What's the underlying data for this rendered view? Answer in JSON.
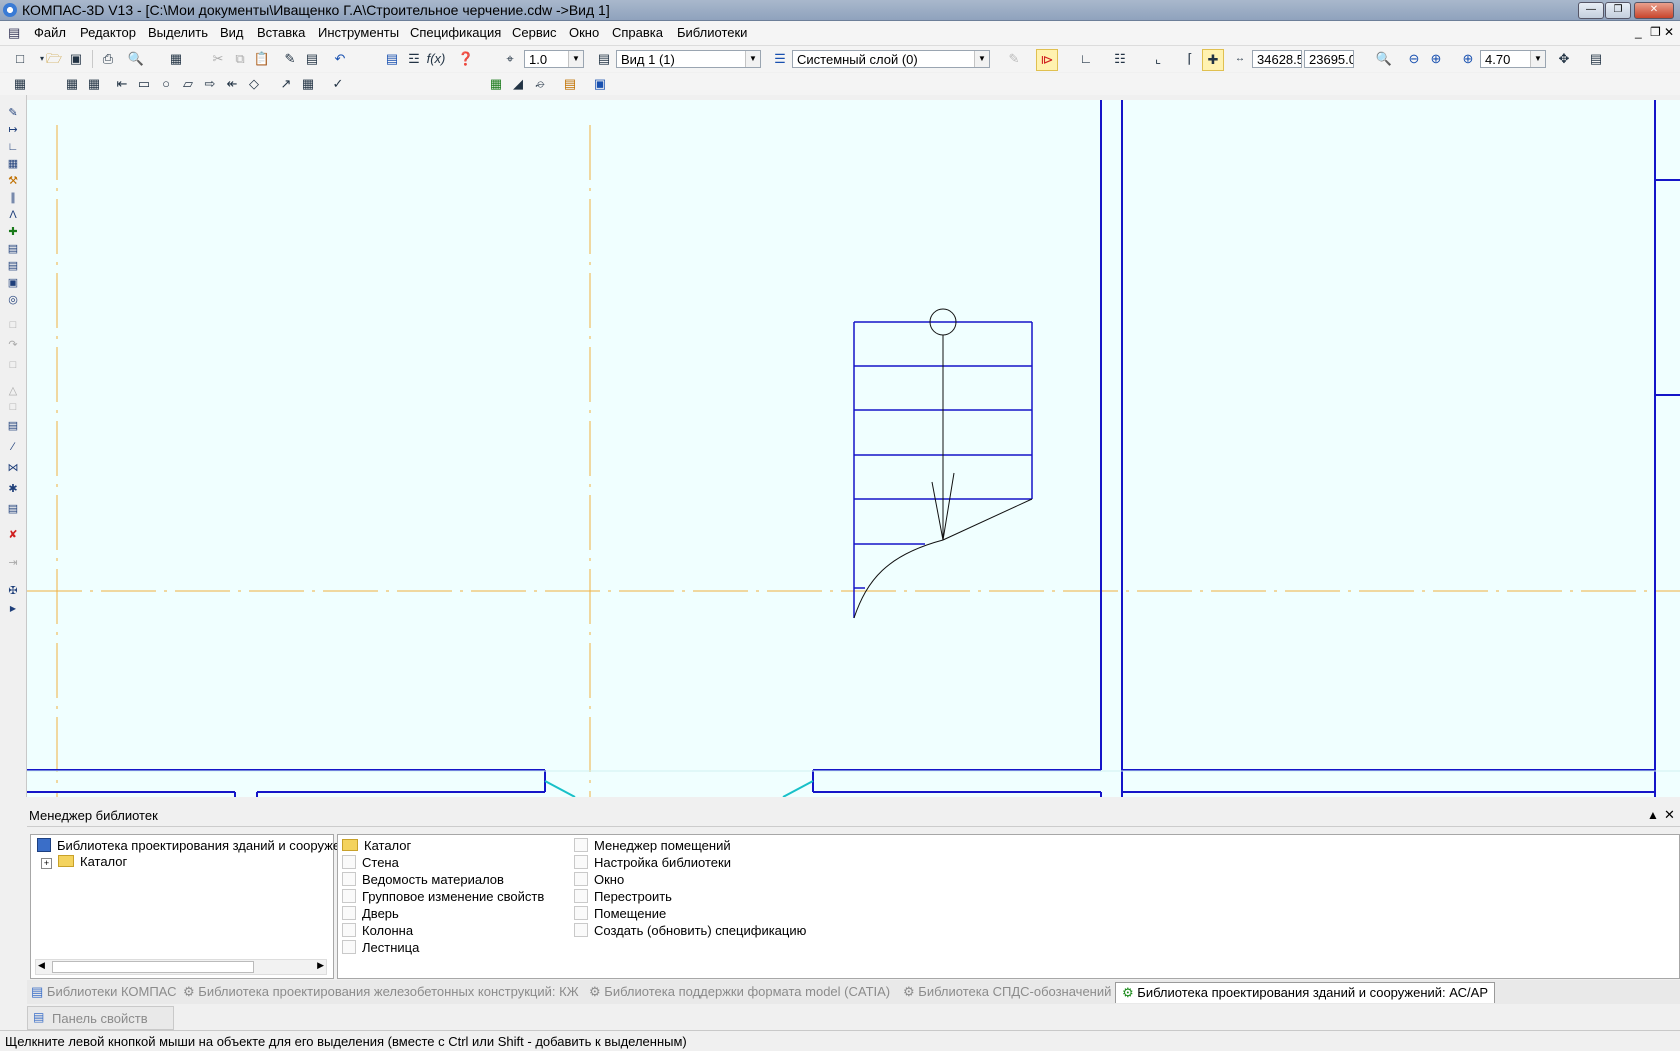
{
  "window": {
    "title": "КОМПАС-3D V13 - [C:\\Мои документы\\Иващенко Г.А\\Строительное черчение.cdw ->Вид 1]"
  },
  "menu": {
    "items": [
      "Файл",
      "Редактор",
      "Выделить",
      "Вид",
      "Вставка",
      "Инструменты",
      "Спецификация",
      "Сервис",
      "Окно",
      "Справка",
      "Библиотеки"
    ]
  },
  "toolbar": {
    "scale_value": "1.0",
    "view_value": "Вид 1 (1)",
    "layer_value": "Системный слой (0)",
    "coord_x": "34628.5",
    "coord_y": "23695.0",
    "zoom_value": "4.70"
  },
  "library_manager": {
    "title": "Менеджер библиотек",
    "tree": {
      "root": "Библиотека проектирования зданий и сооружений: АС/АР",
      "child": "Каталог"
    },
    "commands_col1": [
      "Каталог",
      "Стена",
      "Ведомость материалов",
      "Групповое изменение свойств",
      "Дверь",
      "Колонна",
      "Лестница"
    ],
    "commands_col2": [
      "Менеджер помещений",
      "Настройка библиотеки",
      "Окно",
      "Перестроить",
      "Помещение",
      "Создать (обновить) спецификацию"
    ]
  },
  "tabs": [
    {
      "label": "Библиотеки КОМПАС",
      "active": false
    },
    {
      "label": "Библиотека проектирования железобетонных конструкций: КЖ",
      "active": false
    },
    {
      "label": "Библиотека поддержки формата model (CATIA)",
      "active": false
    },
    {
      "label": "Библиотека СПДС-обозначений",
      "active": false
    },
    {
      "label": "Библиотека проектирования зданий и сооружений: АС/АР",
      "active": true
    }
  ],
  "property_panel": {
    "label": "Панель свойств"
  },
  "status": {
    "text": "Щелкните левой кнопкой мыши на объекте для его выделения (вместе с Ctrl или Shift - добавить к выделенным)"
  },
  "colors": {
    "wall": "#1515c8",
    "axis": "#f0b040",
    "canvas_bg": "#f0ffff",
    "door_swing": "#18c0c8"
  }
}
